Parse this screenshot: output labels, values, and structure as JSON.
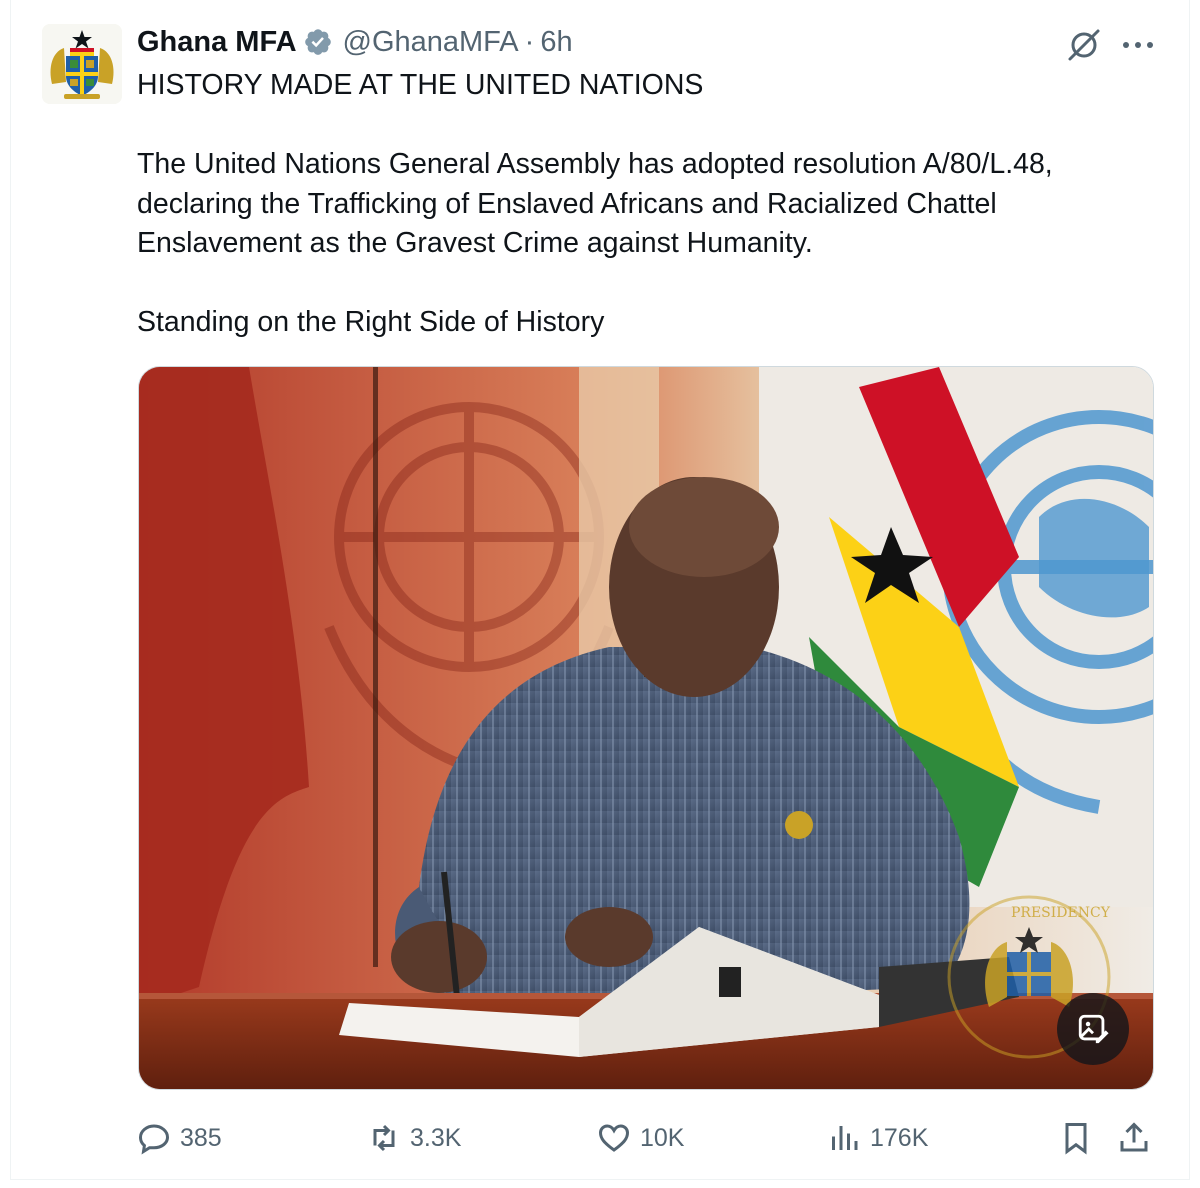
{
  "tweet": {
    "author_name": "Ghana MFA",
    "handle": "@GhanaMFA",
    "separator": "·",
    "time": "6h",
    "text": "HISTORY MADE AT THE UNITED NATIONS\n\nThe United Nations General Assembly has adopted resolution A/80/L.48, declaring the Trafficking of Enslaved Africans and Racialized Chattel Enslavement as the Gravest Crime against Humanity.\n\nStanding on the Right Side of History"
  },
  "media": {
    "watermark_text": "PRESIDENCY"
  },
  "actions": {
    "replies": "385",
    "reposts": "3.3K",
    "likes": "10K",
    "views": "176K"
  },
  "icons": {
    "verified": "verified-badge-icon",
    "grok": "grok-icon",
    "more": "more-icon",
    "reply": "reply-icon",
    "repost": "repost-icon",
    "like": "like-icon",
    "views": "views-icon",
    "bookmark": "bookmark-icon",
    "share": "share-icon",
    "image_tools": "image-tools-icon"
  },
  "colors": {
    "text_primary": "#0f1419",
    "text_secondary": "#536471",
    "verified_fill": "#829aab",
    "ghana_red": "#ce1126",
    "ghana_gold": "#fcd116",
    "ghana_green": "#006b3f",
    "un_blue": "#4f97d0",
    "suit": "#4e5f7a"
  }
}
